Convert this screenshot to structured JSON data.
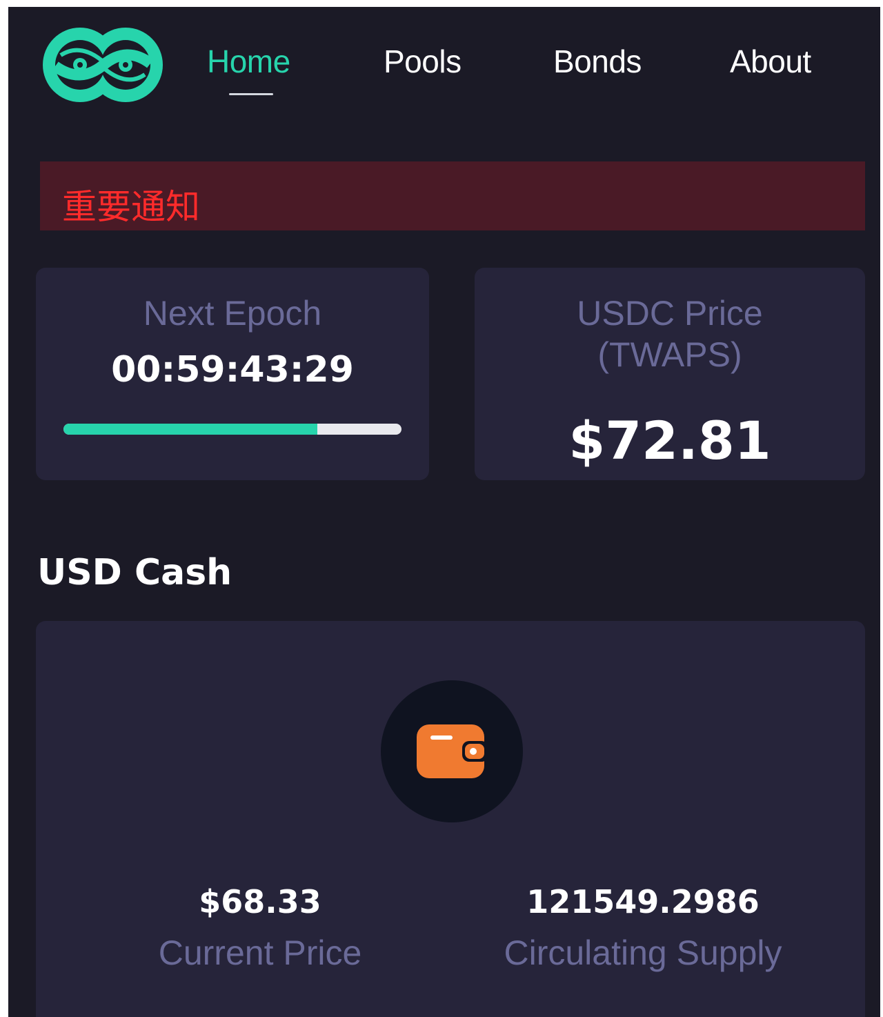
{
  "nav": {
    "logo": "infinity-logo-icon",
    "items": [
      {
        "label": "Home",
        "active": true
      },
      {
        "label": "Pools",
        "active": false
      },
      {
        "label": "Bonds",
        "active": false
      },
      {
        "label": "About",
        "active": false
      }
    ]
  },
  "notice": {
    "text": "重要通知"
  },
  "epoch": {
    "title": "Next Epoch",
    "countdown": "00:59:43:29",
    "progress": 0.75
  },
  "usdc": {
    "title_line1": "USDC Price",
    "title_line2": "(TWAPS)",
    "price": "$72.81"
  },
  "cash": {
    "section_title": "USD Cash",
    "icon": "wallet-icon",
    "current_price": "$68.33",
    "current_price_label": "Current Price",
    "supply": "121549.2986",
    "supply_label": "Circulating Supply"
  },
  "colors": {
    "accent": "#27d4ac",
    "background": "#1b1a26",
    "card": "#26243a",
    "muted_text": "#6a6a98",
    "notice_bg": "#4a1a26",
    "notice_text": "#ff2b2b",
    "wallet": "#f07a30"
  }
}
